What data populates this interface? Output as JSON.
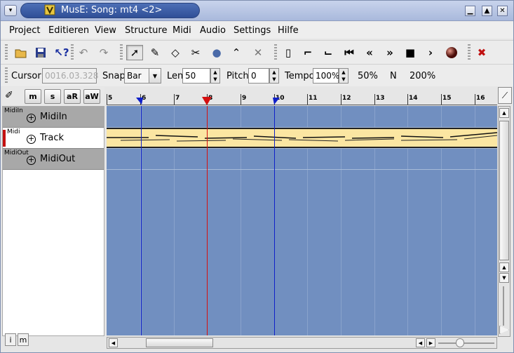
{
  "window": {
    "title": "MusE: Song: mt4 <2>",
    "buttons": {
      "minimize": "▁",
      "maximize": "▲",
      "close": "✕"
    }
  },
  "menu": [
    "Project",
    "Editieren",
    "View",
    "Structure",
    "Midi",
    "Audio",
    "Settings",
    "Hilfe"
  ],
  "toolbar": {
    "icons": [
      "open-folder-icon",
      "save-icon",
      "whats-this-icon",
      "undo-icon",
      "redo-icon",
      "pointer-icon",
      "pencil-icon",
      "eraser-icon",
      "scissors-icon",
      "glue-icon",
      "draw-line-icon",
      "mute-tool-icon",
      "loop-start-icon",
      "punch-in-icon",
      "punch-out-icon",
      "rewind-start-icon",
      "rewind-icon",
      "forward-icon",
      "stop-icon",
      "play-icon",
      "record-icon",
      "panic-icon"
    ]
  },
  "transport": {
    "cursor_label": "Cursor",
    "cursor_value": "0016.03.328",
    "snap_label": "Snap",
    "snap_value": "Bar",
    "len_label": "Len",
    "len_value": "50",
    "pitch_label": "Pitch",
    "pitch_value": "0",
    "tempo_label": "Tempo",
    "tempo_value": "100%",
    "tempo_50": "50%",
    "tempo_n": "N",
    "tempo_200": "200%"
  },
  "track_buttons": {
    "m": "m",
    "s": "s",
    "aR": "aR",
    "aW": "aW"
  },
  "tracks": [
    {
      "type": "MidiIn",
      "name": "MidiIn"
    },
    {
      "type": "Midi",
      "name": "Track"
    },
    {
      "type": "MidiOut",
      "name": "MidiOut"
    }
  ],
  "bottom_buttons": {
    "i": "i",
    "m": "m"
  },
  "ruler": [
    "5",
    "6",
    "7",
    "8",
    "9",
    "10",
    "11",
    "12",
    "13",
    "14",
    "15",
    "16"
  ],
  "colors": {
    "canvas": "#718fc0",
    "part": "#fbe6a2",
    "position_marker": "#d41010",
    "loop_marker": "#1020c8"
  }
}
